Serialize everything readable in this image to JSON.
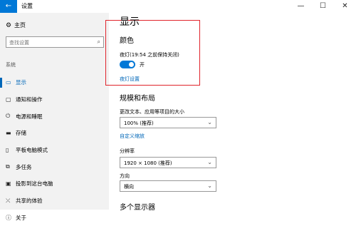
{
  "window": {
    "title": "设置",
    "back_glyph": "←",
    "minimize_glyph": "—",
    "maximize_glyph": "☐",
    "close_glyph": "✕"
  },
  "sidebar": {
    "home": {
      "label": "主页",
      "icon": "gear-icon",
      "glyph": "⚙"
    },
    "search": {
      "placeholder": "查找设置",
      "icon": "search-icon",
      "glyph": "⌕"
    },
    "section": "系统",
    "items": [
      {
        "label": "显示",
        "icon": "monitor-icon",
        "glyph": "▭",
        "active": true
      },
      {
        "label": "通知和操作",
        "icon": "chat-icon",
        "glyph": "▢"
      },
      {
        "label": "电源和睡眠",
        "icon": "power-icon",
        "glyph": "⏻"
      },
      {
        "label": "存储",
        "icon": "drive-icon",
        "glyph": "▬"
      },
      {
        "label": "平板电脑模式",
        "icon": "tablet-icon",
        "glyph": "▯"
      },
      {
        "label": "多任务",
        "icon": "multitask-icon",
        "glyph": "⧉"
      },
      {
        "label": "投影到这台电脑",
        "icon": "project-icon",
        "glyph": "▣"
      },
      {
        "label": "共享的体验",
        "icon": "share-icon",
        "glyph": "⤫"
      },
      {
        "label": "关于",
        "icon": "info-icon",
        "glyph": "ⓘ"
      }
    ]
  },
  "main": {
    "title": "显示",
    "color_header": "颜色",
    "night_light_status": "夜灯(19:54 之前保持关闭)",
    "toggle_state": "开",
    "night_light_link": "夜灯设置",
    "scale_header": "规模和布局",
    "scale_label": "更改文本、应用等项目的大小",
    "scale_value": "100% (推荐)",
    "custom_scale_link": "自定义缩放",
    "resolution_label": "分辨率",
    "resolution_value": "1920 × 1080 (推荐)",
    "orientation_label": "方向",
    "orientation_value": "横向",
    "multi_display_header": "多个显示器",
    "chevron_glyph": "⌄"
  },
  "colors": {
    "accent": "#0078d7",
    "highlight_box": "#e0232b",
    "sidebar_bg": "#f2f2f2"
  }
}
